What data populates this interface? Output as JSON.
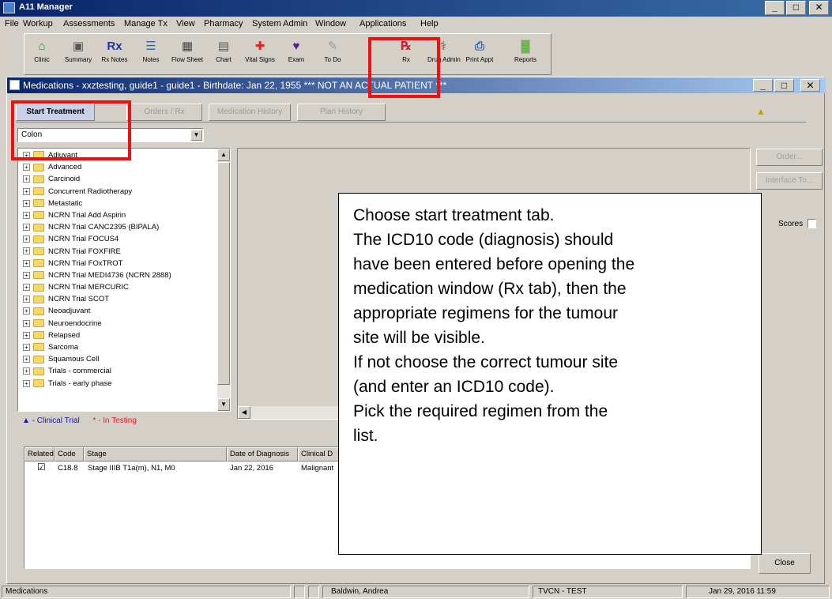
{
  "app": {
    "title": "A11 Manager"
  },
  "menu": [
    "File",
    "Workup",
    "Assessments",
    "Manage Tx",
    "View",
    "Pharmacy",
    "System Admin",
    "Window",
    "Applications",
    "Help"
  ],
  "toolbar": [
    {
      "label": "Clinic",
      "icon": "clinic-icon",
      "glyph": "⌂"
    },
    {
      "label": "Summary",
      "icon": "summary-icon",
      "glyph": "▣"
    },
    {
      "label": "Rx Notes",
      "icon": "rx-notes-icon",
      "glyph": "Rx"
    },
    {
      "label": "Notes",
      "icon": "notes-icon",
      "glyph": "☰"
    },
    {
      "label": "Flow Sheet",
      "icon": "flow-sheet-icon",
      "glyph": "▦"
    },
    {
      "label": "Chart",
      "icon": "chart-icon",
      "glyph": "▤"
    },
    {
      "label": "Vital Signs",
      "icon": "vital-signs-icon",
      "glyph": "✚"
    },
    {
      "label": "Exam",
      "icon": "exam-icon",
      "glyph": "♥"
    },
    {
      "label": "To Do",
      "icon": "todo-icon",
      "glyph": "✎"
    },
    {
      "label": "Rx",
      "icon": "rx-icon",
      "glyph": "℞"
    },
    {
      "label": "Drug Admin",
      "icon": "drug-admin-icon",
      "glyph": "⚕"
    },
    {
      "label": "Print Appt",
      "icon": "print-appt-icon",
      "glyph": "⎙"
    },
    {
      "label": "Reports",
      "icon": "reports-icon",
      "glyph": "▓"
    }
  ],
  "medwin": {
    "title": "Medications - xxztesting, guide1 - guide1 - Birthdate: Jan 22, 1955 *** NOT AN ACTUAL PATIENT ***",
    "tabs": [
      "Start Treatment",
      "Orders / Rx",
      "Medication History",
      "Plan History"
    ],
    "site_select": "Colon",
    "tree": [
      "Adjuvant",
      "Advanced",
      "Carcinoid",
      "Concurrent Radiotherapy",
      "Metastatic",
      "NCRN Trial Add Aspirin",
      "NCRN Trial CANC2395 (BIPALA)",
      "NCRN Trial FOCUS4",
      "NCRN Trial FOXFIRE",
      "NCRN Trial FOxTROT",
      "NCRN Trial MEDI4736 (NCRN 2888)",
      "NCRN Trial MERCURIC",
      "NCRN Trial SCOT",
      "Neoadjuvant",
      "Neuroendocrine",
      "Relapsed",
      "Sarcoma",
      "Squamous Cell",
      "Trials - commercial",
      "Trials - early phase"
    ],
    "legend_trial": "- Clinical Trial",
    "legend_testing": "* - In Testing",
    "buttons": {
      "order": "Order...",
      "interface": "Interface To...",
      "scores": "Scores",
      "close": "Close"
    },
    "grid_headers": [
      "Related",
      "Code",
      "Stage",
      "Date of Diagnosis",
      "Clinical D"
    ],
    "grid_row": {
      "code": "C18.8",
      "stage": "Stage IIIB T1a(m), N1, M0",
      "date": "Jan 22, 2016",
      "clinical": "Malignant"
    }
  },
  "callout": [
    "Choose start treatment tab.",
    "The ICD10 code (diagnosis) should",
    "have been entered before opening the",
    "medication window (Rx tab), then the",
    "appropriate regimens for the tumour",
    "site will be visible.",
    "If not choose the correct tumour site",
    "(and enter an ICD10 code).",
    "Pick the required regimen from the",
    "list."
  ],
  "status": {
    "left": "Medications",
    "user": "Baldwin, Andrea",
    "env": "TVCN - TEST",
    "datetime": "Jan 29, 2016 11:59"
  },
  "colors": {
    "title_bar": "#0a246a",
    "highlight": "#ee1111",
    "trial_legend": "#1a1ab0",
    "testing_legend": "#e02020"
  }
}
